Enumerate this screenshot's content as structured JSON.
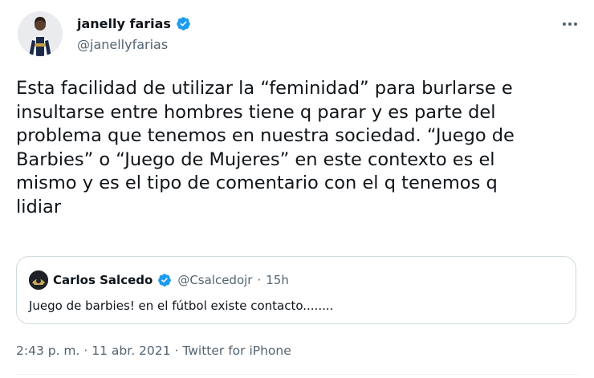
{
  "colors": {
    "text_primary": "#0f1419",
    "text_secondary": "#536471",
    "verified_blue": "#1d9bf0",
    "border": "#cfd9de"
  },
  "author": {
    "name": "janelly farias",
    "handle": "@janellyfarias",
    "verified_icon": "verified-badge-icon",
    "avatar_icon": "user-avatar"
  },
  "menu": {
    "more_icon": "more-options-icon"
  },
  "tweet": {
    "text": "Esta facilidad de utilizar la “feminidad” para burlarse e\ninsultarse entre hombres tiene q parar y es parte del\nproblema que tenemos en nuestra sociedad. “Juego de\nBarbies” o “Juego de Mujeres” en este contexto es el\nmismo y es el tipo de comentario con el q tenemos q\nlidiar"
  },
  "quoted_tweet": {
    "name": "Carlos Salcedo",
    "handle": "@Csalcedojr",
    "separator": "·",
    "time": "15h",
    "text": "Juego de barbies! en el fútbol existe contacto........"
  },
  "meta": {
    "time": "2:43 p. m.",
    "separator_1": "·",
    "date": "11 abr. 2021",
    "separator_2": "·",
    "source": "Twitter for iPhone"
  }
}
